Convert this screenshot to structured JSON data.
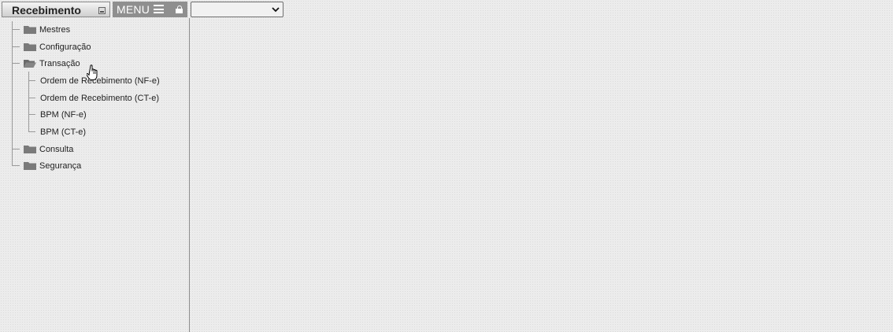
{
  "header": {
    "app_title": "Recebimento",
    "menu_label": "MENU",
    "select_value": ""
  },
  "tree": {
    "items": [
      {
        "label": "Mestres",
        "icon": "folder-icon",
        "expanded": false
      },
      {
        "label": "Configuração",
        "icon": "folder-icon",
        "expanded": false
      },
      {
        "label": "Transação",
        "icon": "folder-open-icon",
        "expanded": true,
        "children": [
          {
            "label": "Ordem de Recebimento (NF-e)"
          },
          {
            "label": "Ordem de Recebimento (CT-e)"
          },
          {
            "label": "BPM (NF-e)"
          },
          {
            "label": "BPM (CT-e)"
          }
        ]
      },
      {
        "label": "Consulta",
        "icon": "folder-icon",
        "expanded": false
      },
      {
        "label": "Segurança",
        "icon": "folder-icon",
        "expanded": false
      }
    ]
  },
  "colors": {
    "background": "#ececec",
    "menu_button": "#8f8f8f",
    "folder": "#7a7a7a",
    "tree_line": "#9a9a9a"
  },
  "cursor": {
    "type": "hand-pointer"
  }
}
